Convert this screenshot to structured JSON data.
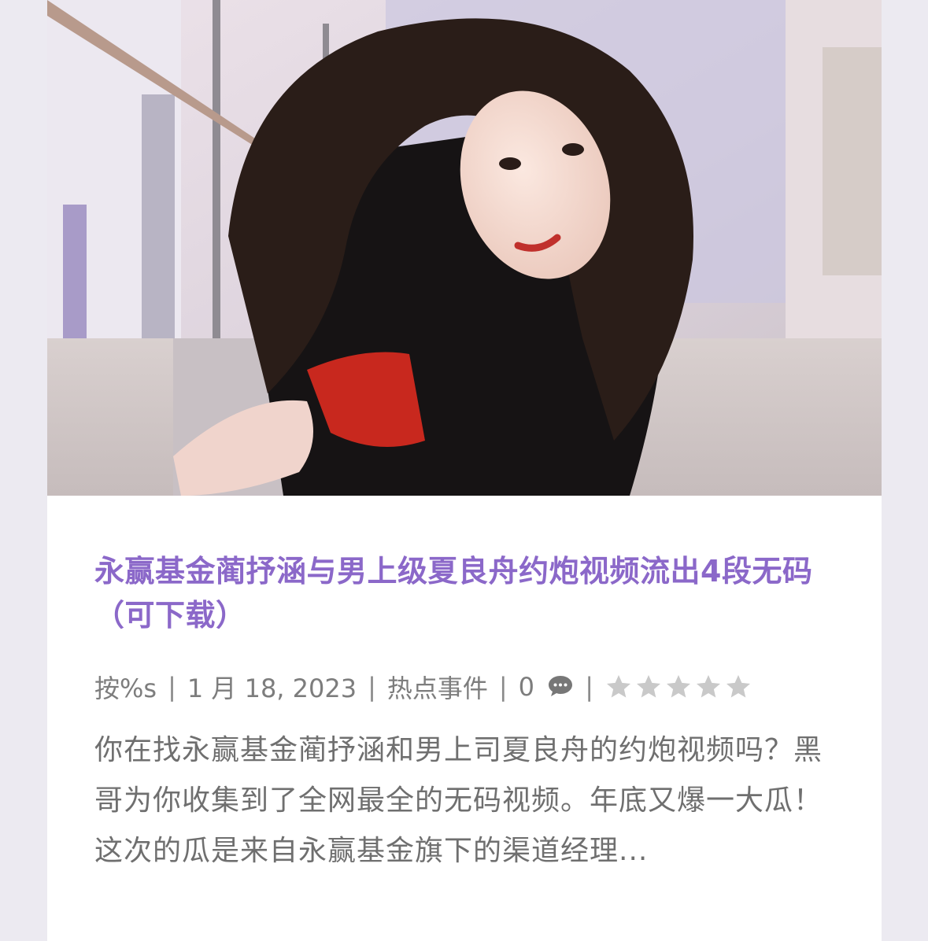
{
  "post": {
    "title": "永赢基金蔺抒涵与男上级夏良舟约炮视频流出4段无码（可下载）",
    "author": "按%s",
    "date": "1 月 18, 2023",
    "category": "热点事件",
    "comment_count": "0",
    "rating": 0,
    "rating_max": 5,
    "excerpt": "你在找永赢基金蔺抒涵和男上司夏良舟的约炮视频吗？黑哥为你收集到了全网最全的无码视频。年底又爆一大瓜！这次的瓜是来自永赢基金旗下的渠道经理..."
  },
  "meta": {
    "separator": "|"
  },
  "icons": {
    "comment": "comment-icon",
    "rating": "star-icon"
  },
  "colors": {
    "title": "#8b68c9",
    "meta_text": "#7d7d7d",
    "excerpt_text": "#6f6f6f",
    "card_background": "#ffffff",
    "page_background": "#eceaf1",
    "star_empty": "#c9c9c9"
  }
}
